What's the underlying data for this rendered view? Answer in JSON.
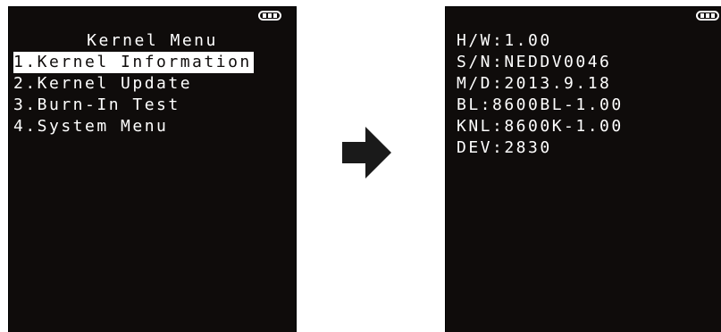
{
  "kernel_menu": {
    "title": "Kernel Menu",
    "items": [
      {
        "label": "1.Kernel Information",
        "selected": true
      },
      {
        "label": "2.Kernel Update",
        "selected": false
      },
      {
        "label": "3.Burn-In Test",
        "selected": false
      },
      {
        "label": "4.System Menu",
        "selected": false
      }
    ]
  },
  "kernel_info": {
    "lines": [
      "H/W:1.00",
      "S/N:NEDDV0046",
      "M/D:2013.9.18",
      "BL:8600BL-1.00",
      "KNL:8600K-1.00",
      "DEV:2830"
    ]
  },
  "icons": {
    "battery": "battery-icon",
    "arrow": "right-arrow-icon"
  },
  "colors": {
    "screen_background": "#0f0c0b",
    "screen_text": "#ffffff",
    "selection_highlight": "#ffffff",
    "arrow": "#1a1a1a"
  }
}
